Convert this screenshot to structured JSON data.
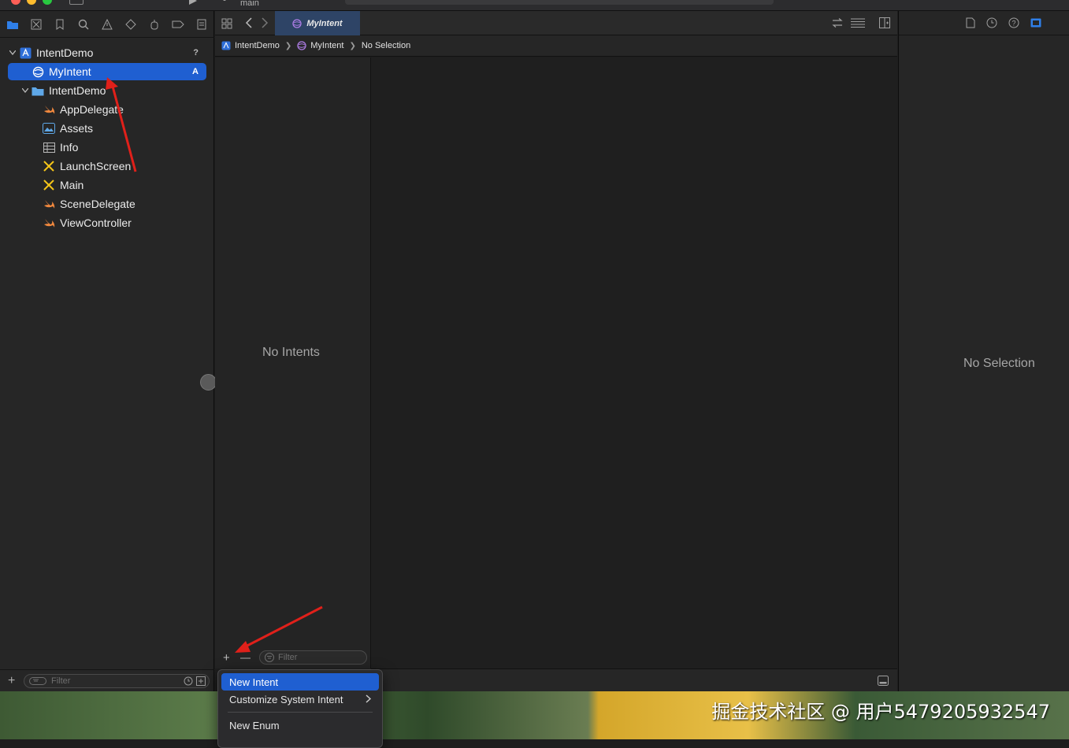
{
  "toolbar": {
    "branch": "main"
  },
  "navigator": {
    "tree": [
      {
        "label": "IntentDemo",
        "badge": "?",
        "icon": "xcode-project-icon"
      },
      {
        "label": "MyIntent",
        "badge": "A",
        "icon": "intent-definition-icon"
      },
      {
        "label": "IntentDemo",
        "icon": "folder-icon"
      },
      {
        "label": "AppDelegate",
        "icon": "swift-file-icon"
      },
      {
        "label": "Assets",
        "icon": "asset-catalog-icon"
      },
      {
        "label": "Info",
        "icon": "plist-icon"
      },
      {
        "label": "LaunchScreen",
        "icon": "storyboard-icon"
      },
      {
        "label": "Main",
        "icon": "storyboard-icon"
      },
      {
        "label": "SceneDelegate",
        "icon": "swift-file-icon"
      },
      {
        "label": "ViewController",
        "icon": "swift-file-icon"
      }
    ],
    "filter_placeholder": "Filter"
  },
  "editor": {
    "tab_label": "MyIntent",
    "jumpbar": [
      "IntentDemo",
      "MyIntent",
      "No Selection"
    ],
    "empty_list": "No Intents",
    "filter_placeholder": "Filter"
  },
  "inspector": {
    "empty": "No Selection"
  },
  "menu": {
    "items": [
      "New Intent",
      "Customize System Intent",
      "New Enum"
    ]
  },
  "watermark": "掘金技术社区 @ 用户5479205932547",
  "colors": {
    "selection": "#1f5fd1",
    "swift": "#f0883e",
    "storyboard": "#f5c518",
    "folder": "#5fa8e8",
    "intent": "#b07ee8",
    "annotation_arrow": "#e0201a"
  }
}
